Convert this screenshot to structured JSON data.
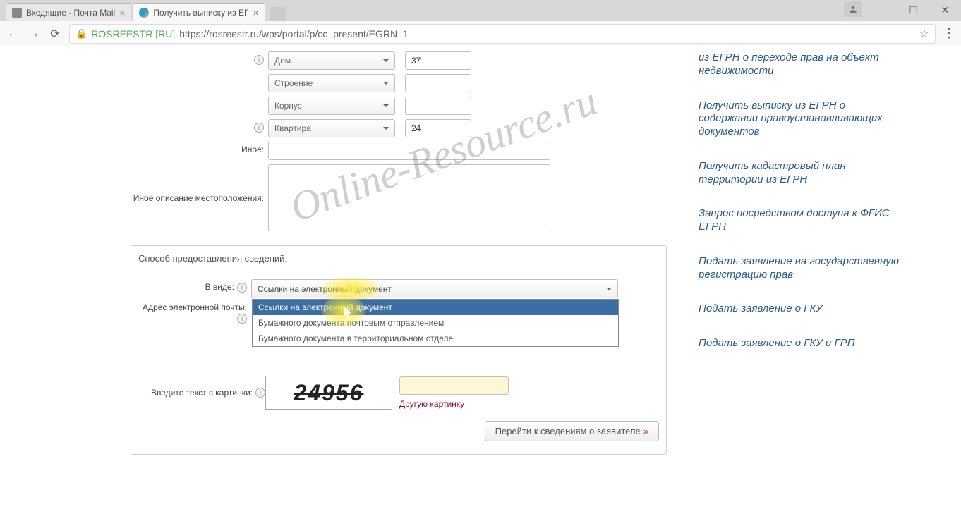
{
  "browser": {
    "tabs": [
      {
        "title": "Входящие - Почта Mail"
      },
      {
        "title": "Получить выписку из ЕГ"
      }
    ],
    "url_host": "ROSREESTR [RU]",
    "url_path": "https://rosreestr.ru/wps/portal/p/cc_present/EGRN_1"
  },
  "address_form": {
    "house_type_label": "Дом",
    "house_value": "37",
    "building_type_label": "Строение",
    "building_value": "",
    "korpus_type_label": "Корпус",
    "korpus_value": "",
    "apartment_type_label": "Квартира",
    "apartment_value": "24",
    "other_label": "Иное:",
    "other_value": "",
    "other_desc_label": "Иное описание местоположения:",
    "other_desc_value": ""
  },
  "delivery": {
    "legend": "Способ предоставления сведений:",
    "format_label": "В виде:",
    "format_selected": "Ссылки на электронный документ",
    "options": [
      "Ссылки на электронный документ",
      "Бумажного документа почтовым отправлением",
      "Бумажного документа в территориальном отделе"
    ],
    "email_label": "Адрес электронной почты:",
    "email_value": ""
  },
  "captcha": {
    "label": "Введите текст с картинки:",
    "image_text": "24956",
    "refresh_link": "Другую картинку"
  },
  "next_button": "Перейти к сведениям о заявителе",
  "sidebar": {
    "links": [
      "из ЕГРН о переходе прав на объект недвижимости",
      "Получить выписку из ЕГРН о содержании правоустанавливающих документов",
      "Получить кадастровый план территории из ЕГРН",
      "Запрос посредством доступа к ФГИС ЕГРН",
      "Подать заявление на государственную регистрацию прав",
      "Подать заявление о ГКУ",
      "Подать заявление о ГКУ и ГРП"
    ]
  },
  "watermark": "Online-Resource.ru"
}
